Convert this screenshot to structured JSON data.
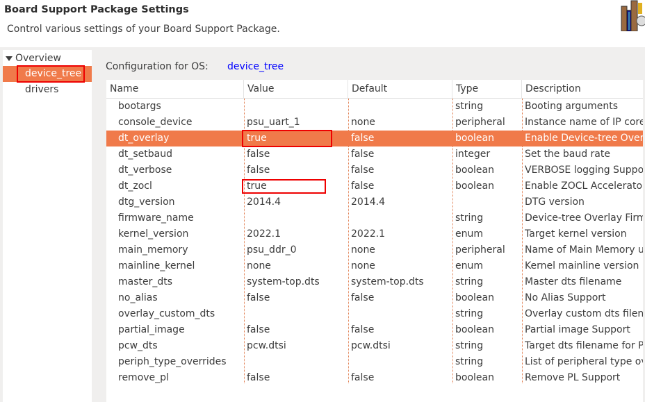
{
  "header": {
    "title": "Board Support Package Settings",
    "subtitle": "Control various settings of your Board Support Package."
  },
  "tree": {
    "root": "Overview",
    "items": [
      {
        "label": "device_tree",
        "selected": true
      },
      {
        "label": "drivers",
        "selected": false
      }
    ]
  },
  "config": {
    "label": "Configuration for OS:",
    "value": "device_tree"
  },
  "table": {
    "columns": [
      "Name",
      "Value",
      "Default",
      "Type",
      "Description"
    ],
    "rows": [
      [
        "bootargs",
        "",
        "",
        "string",
        "Booting arguments"
      ],
      [
        "console_device",
        "psu_uart_1",
        "none",
        "peripheral",
        "Instance name of IP core f"
      ],
      [
        "dt_overlay",
        "true",
        "false",
        "boolean",
        "Enable Device-tree Overlay"
      ],
      [
        "dt_setbaud",
        "false",
        "false",
        "integer",
        "Set the baud rate"
      ],
      [
        "dt_verbose",
        "false",
        "false",
        "boolean",
        "VERBOSE logging Support"
      ],
      [
        "dt_zocl",
        "true",
        "false",
        "boolean",
        "Enable ZOCL Accelerator p"
      ],
      [
        "dtg_version",
        "2014.4",
        "2014.4",
        "",
        "DTG version"
      ],
      [
        "firmware_name",
        "",
        "",
        "string",
        "Device-tree Overlay Firmw"
      ],
      [
        "kernel_version",
        "2022.1",
        "2022.1",
        "enum",
        "Target kernel version"
      ],
      [
        "main_memory",
        "psu_ddr_0",
        "none",
        "peripheral",
        "Name of Main Memory us"
      ],
      [
        "mainline_kernel",
        "none",
        "none",
        "enum",
        "Kernel mainline version"
      ],
      [
        "master_dts",
        "system-top.dts",
        "system-top.dts",
        "string",
        "Master dts filename"
      ],
      [
        "no_alias",
        "false",
        "false",
        "boolean",
        "No Alias Support"
      ],
      [
        "overlay_custom_dts",
        "",
        "",
        "string",
        "Overlay custom dts filenar"
      ],
      [
        "partial_image",
        "false",
        "false",
        "boolean",
        "Partial image Support"
      ],
      [
        "pcw_dts",
        "pcw.dtsi",
        "pcw.dtsi",
        "string",
        "Target dts filename for PC"
      ],
      [
        "periph_type_overrides",
        "",
        "",
        "string",
        "List of peripheral type ove"
      ],
      [
        "remove_pl",
        "false",
        "false",
        "boolean",
        "Remove PL Support"
      ]
    ],
    "selected_row": 2,
    "highlighted_value_rows": [
      2,
      5
    ]
  },
  "colors": {
    "selection": "#f07a4a",
    "highlight_box": "#ee0000",
    "link": "#0000ff"
  }
}
